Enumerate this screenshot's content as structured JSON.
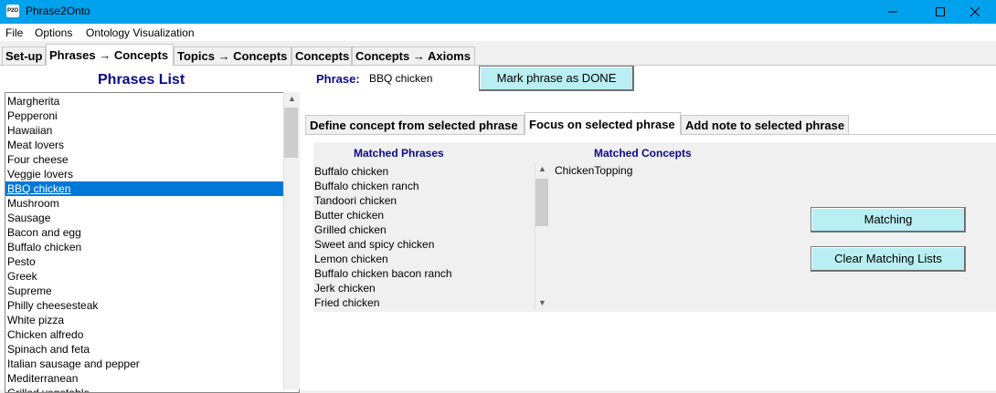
{
  "window": {
    "title": "Phrase2Onto",
    "icon_text": "P2O"
  },
  "menu": [
    "File",
    "Options",
    "Ontology Visualization"
  ],
  "tabs": [
    "Set-up",
    "Phrases → Concepts",
    "Topics → Concepts",
    "Concepts",
    "Concepts → Axioms"
  ],
  "selected_tab": "Phrases → Concepts",
  "phrases_panel": {
    "title": "Phrases List",
    "items": [
      "Margherita",
      "Pepperoni",
      "Hawaiian",
      "Meat lovers",
      "Four cheese",
      "Veggie lovers",
      "BBQ chicken",
      "Mushroom",
      "Sausage",
      "Bacon and egg",
      "Buffalo chicken",
      "Pesto",
      "Greek",
      "Supreme",
      "Philly cheesesteak",
      "White pizza",
      "Chicken alfredo",
      "Spinach and feta",
      "Italian sausage and pepper",
      "Mediterranean",
      "Grilled vegetable"
    ],
    "selected": "BBQ chicken"
  },
  "phrase_header": {
    "label": "Phrase:",
    "value": "BBQ chicken",
    "done_button": "Mark phrase as DONE"
  },
  "inner_tabs": [
    "Define concept from selected phrase",
    "Focus on selected phrase",
    "Add note to selected phrase"
  ],
  "selected_inner_tab": "Focus on selected phrase",
  "focus": {
    "matched_phrases_header": "Matched Phrases",
    "matched_concepts_header": "Matched Concepts",
    "matched_phrases": [
      "Buffalo chicken",
      "Buffalo chicken ranch",
      "Tandoori chicken",
      "Butter chicken",
      "Grilled chicken",
      "Sweet and spicy chicken",
      "Lemon chicken",
      "Buffalo chicken bacon ranch",
      "Jerk chicken",
      "Fried chicken"
    ],
    "matched_concepts": [
      "ChickenTopping"
    ],
    "matching_button": "Matching",
    "clear_button": "Clear Matching Lists"
  },
  "colors": {
    "titlebar": "#00a2ed",
    "selection": "#0078d7",
    "button": "#b9eef2",
    "heading": "#0a0a8a"
  }
}
